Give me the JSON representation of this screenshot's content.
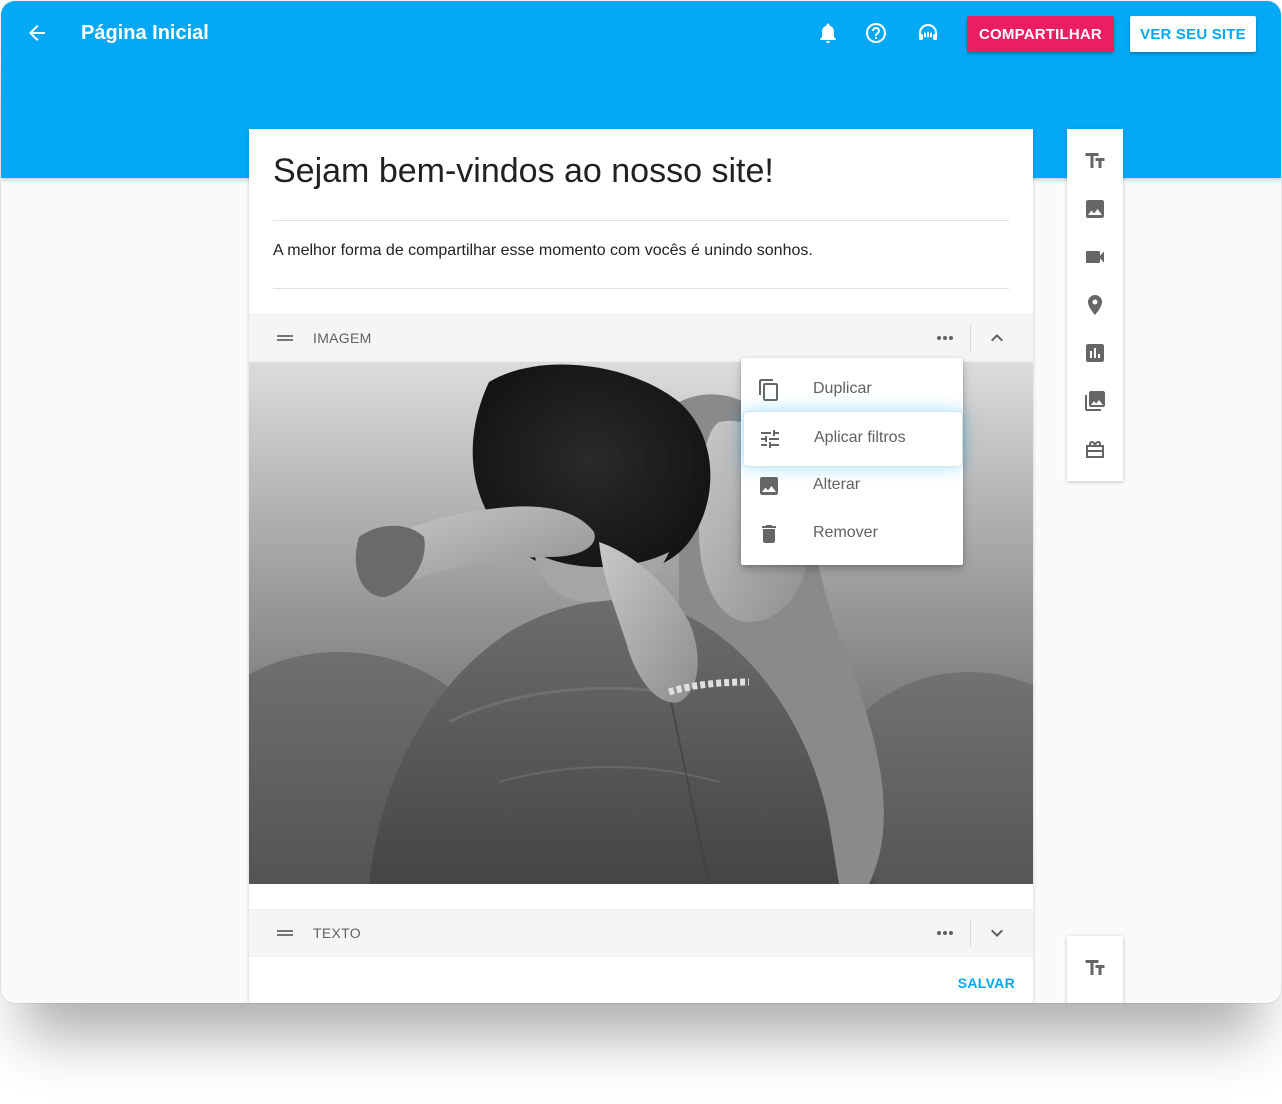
{
  "header": {
    "title": "Página Inicial",
    "share_label": "COMPARTILHAR",
    "view_site_label": "VER SEU SITE",
    "icons": [
      "arrow-back-icon",
      "bell-icon",
      "help-icon",
      "support-agent-icon"
    ]
  },
  "content": {
    "headline": "Sejam bem-vindos ao nosso site!",
    "body": "A melhor forma de compartilhar esse momento com vocês é unindo sonhos."
  },
  "image_section": {
    "label": "IMAGEM",
    "state": "expanded"
  },
  "context_menu": {
    "items": [
      {
        "label": "Duplicar",
        "icon": "copy-icon"
      },
      {
        "label": "Aplicar filtros",
        "icon": "tune-icon",
        "highlighted": true
      },
      {
        "label": "Alterar",
        "icon": "image-icon"
      },
      {
        "label": "Remover",
        "icon": "trash-icon"
      }
    ]
  },
  "text_section": {
    "label": "TEXTO",
    "state": "collapsed",
    "save_label": "SALVAR"
  },
  "toolbar": {
    "tools": [
      "text-format-icon",
      "image-icon",
      "video-icon",
      "location-icon",
      "chart-icon",
      "gallery-icon",
      "gift-icon"
    ]
  },
  "colors": {
    "primary": "#03a9f4",
    "accent": "#ec1e63",
    "icon": "#666666"
  }
}
